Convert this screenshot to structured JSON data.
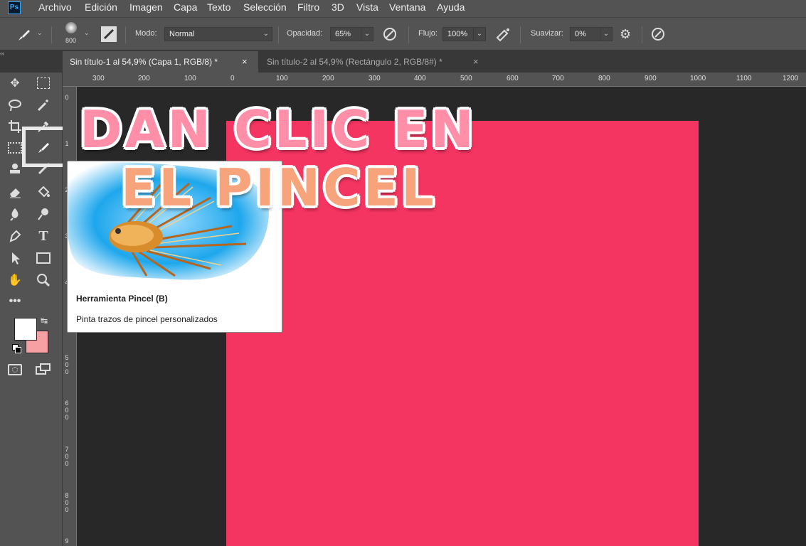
{
  "app": {
    "logo": "Ps"
  },
  "menu": [
    "Archivo",
    "Edición",
    "Imagen",
    "Capa",
    "Texto",
    "Selección",
    "Filtro",
    "3D",
    "Vista",
    "Ventana",
    "Ayuda"
  ],
  "options": {
    "brush_size": "800",
    "mode_label": "Modo:",
    "mode_value": "Normal",
    "opacity_label": "Opacidad:",
    "opacity_value": "65%",
    "flow_label": "Flujo:",
    "flow_value": "100%",
    "smooth_label": "Suavizar:",
    "smooth_value": "0%"
  },
  "tabs": [
    {
      "label": "Sin título-1 al 54,9% (Capa 1, RGB/8) *",
      "close": "×",
      "active": true
    },
    {
      "label": "Sin título-2 al 54,9% (Rectángulo 2, RGB/8#) *",
      "close": "×",
      "active": false
    }
  ],
  "collapse_glyph": "‹‹",
  "ruler_top": [
    "300",
    "200",
    "100",
    "0",
    "100",
    "200",
    "300",
    "400",
    "500",
    "600",
    "700",
    "800",
    "900",
    "1000",
    "1100",
    "1200"
  ],
  "ruler_left": [
    "0",
    "1",
    "2",
    "3",
    "4",
    "5 0 0",
    "6 0 0",
    "7 0 0",
    "8 0 0",
    "9"
  ],
  "tooltip": {
    "title": "Herramienta Pincel (B)",
    "description": "Pinta trazos de pincel personalizados"
  },
  "overlay": {
    "line1": "DAN CLIC EN",
    "line2": "EL PINCEL"
  },
  "colors": {
    "canvas": "#f43461",
    "foreground": "#ffffff",
    "background": "#f7a0a4",
    "overlay_text": "#ff8fa8"
  },
  "icons": [
    "brush-tool-icon",
    "brush-preset-icon",
    "airbrush-icon",
    "pressure-opacity-icon",
    "pressure-size-icon",
    "gear-icon",
    "symmetry-icon",
    "move-icon",
    "marquee-icon",
    "lasso-icon",
    "magic-wand-icon",
    "crop-icon",
    "eyedropper-icon",
    "frame-icon",
    "brush-icon",
    "stamp-icon",
    "history-brush-icon",
    "eraser-icon",
    "bucket-icon",
    "blur-icon",
    "dodge-icon",
    "pen-icon",
    "type-icon",
    "path-select-icon",
    "rectangle-icon",
    "hand-icon",
    "zoom-icon",
    "more-tools-icon",
    "swap-colors-icon",
    "default-colors-icon",
    "quick-mask-icon",
    "screen-mode-icon"
  ]
}
